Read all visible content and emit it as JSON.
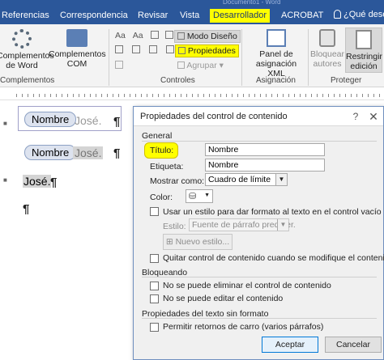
{
  "window": {
    "title_partial": "Documento1 - Word"
  },
  "tabs": [
    {
      "label": "Referencias"
    },
    {
      "label": "Correspondencia"
    },
    {
      "label": "Revisar"
    },
    {
      "label": "Vista"
    },
    {
      "label": "Desarrollador",
      "active": true,
      "highlighted": true
    },
    {
      "label": "ACROBAT"
    }
  ],
  "tell_me": "¿Qué dese",
  "ribbon": {
    "complementos_word": "Complementos de Word",
    "complementos_com": "Complementos COM",
    "group_complementos": "Complementos",
    "modo_diseno": "Modo Diseño",
    "propiedades": "Propiedades",
    "agrupar": "Agrupar",
    "group_controles": "Controles",
    "panel_xml": "Panel de asignación XML",
    "group_asignacion": "Asignación",
    "bloquear_autores": "Bloquear autores",
    "restringir_edicion": "Restringir edición",
    "group_proteger": "Proteger"
  },
  "document": {
    "cc1_tag": "Nombre",
    "cc1_value": "José.",
    "cc2_tag": "Nombre",
    "cc2_value": "José.",
    "plain_value": "José.",
    "pilcrow": "¶"
  },
  "dialog": {
    "title": "Propiedades del control de contenido",
    "help": "?",
    "close": "✕",
    "general": {
      "heading": "General",
      "titulo_label": "Título:",
      "titulo_value": "Nombre",
      "etiqueta_label": "Etiqueta:",
      "etiqueta_value": "Nombre",
      "mostrar_label": "Mostrar como:",
      "mostrar_value": "Cuadro de límite",
      "color_label": "Color:",
      "usar_estilo": "Usar un estilo para dar formato al texto en el control vacío",
      "estilo_label": "Estilo:",
      "estilo_value": "Fuente de párrafo predeter.",
      "nuevo_estilo": "Nuevo estilo...",
      "quitar_control": "Quitar control de contenido cuando se modifique el contenido"
    },
    "bloqueo": {
      "heading": "Bloqueando",
      "no_eliminar": "No se puede eliminar el control de contenido",
      "no_editar": "No se puede editar el contenido"
    },
    "texto": {
      "heading": "Propiedades del texto sin formato",
      "permitir": "Permitir retornos de carro (varios párrafos)"
    },
    "aceptar": "Aceptar",
    "cancelar": "Cancelar"
  }
}
